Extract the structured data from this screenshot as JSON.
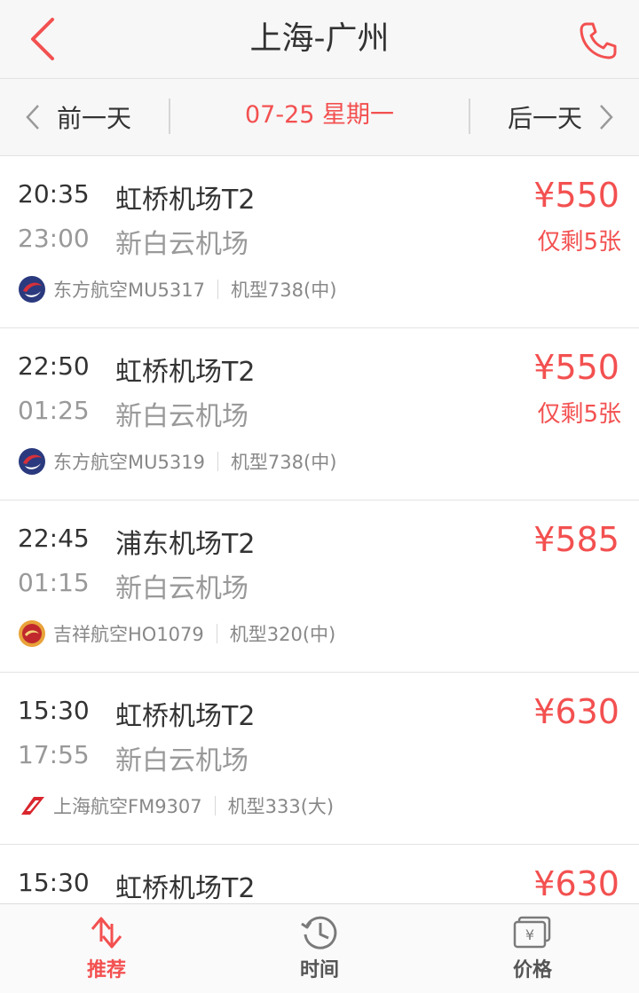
{
  "header": {
    "title": "上海-广州"
  },
  "date_bar": {
    "prev_label": "前一天",
    "current": "07-25 星期一",
    "next_label": "后一天"
  },
  "flights": [
    {
      "dep_time": "20:35",
      "dep_airport": "虹桥机场T2",
      "arr_time": "23:00",
      "arr_airport": "新白云机场",
      "price": "¥550",
      "remain": "仅剩5张",
      "airline": "东方航空MU5317",
      "plane": "机型738(中)",
      "logo": "china-eastern-logo-icon"
    },
    {
      "dep_time": "22:50",
      "dep_airport": "虹桥机场T2",
      "arr_time": "01:25",
      "arr_airport": "新白云机场",
      "price": "¥550",
      "remain": "仅剩5张",
      "airline": "东方航空MU5319",
      "plane": "机型738(中)",
      "logo": "china-eastern-logo-icon"
    },
    {
      "dep_time": "22:45",
      "dep_airport": "浦东机场T2",
      "arr_time": "01:15",
      "arr_airport": "新白云机场",
      "price": "¥585",
      "remain": "",
      "airline": "吉祥航空HO1079",
      "plane": "机型320(中)",
      "logo": "juneyao-logo-icon"
    },
    {
      "dep_time": "15:30",
      "dep_airport": "虹桥机场T2",
      "arr_time": "17:55",
      "arr_airport": "新白云机场",
      "price": "¥630",
      "remain": "",
      "airline": "上海航空FM9307",
      "plane": "机型333(大)",
      "logo": "shanghai-airlines-logo-icon"
    },
    {
      "dep_time": "15:30",
      "dep_airport": "虹桥机场T2",
      "arr_time": "",
      "arr_airport": "",
      "price": "¥630",
      "remain": "",
      "airline": "",
      "plane": "",
      "logo": ""
    }
  ],
  "tabbar": {
    "tabs": [
      {
        "label": "推荐",
        "icon": "sort-arrows-icon",
        "active": true
      },
      {
        "label": "时间",
        "icon": "clock-icon",
        "active": false
      },
      {
        "label": "价格",
        "icon": "price-ticket-icon",
        "active": false
      }
    ]
  },
  "colors": {
    "accent": "#f35050",
    "text_primary": "#333333",
    "text_secondary": "#999999",
    "bar_bg": "#f7f7f7"
  }
}
